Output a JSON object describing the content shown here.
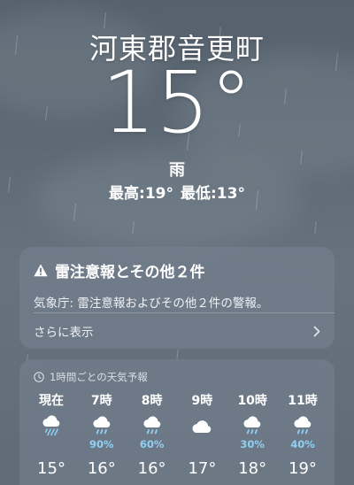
{
  "location": {
    "city": "河東郡音更町"
  },
  "current": {
    "temperature": "15°",
    "condition": "雨",
    "high": "最高:19°",
    "low": "最低:13°"
  },
  "alert": {
    "title": "雷注意報とその他２件",
    "body": "気象庁: 雷注意報およびその他２件の警報。",
    "more_label": "さらに表示",
    "icon": "warning-icon"
  },
  "hourly": {
    "header": "1時間ごとの天気予報",
    "header_icon": "clock-icon",
    "accent_color": "#8fd0f5",
    "items": [
      {
        "label": "現在",
        "icon": "heavy-rain-icon",
        "prob": "",
        "temp": "15°"
      },
      {
        "label": "7時",
        "icon": "rain-icon",
        "prob": "90%",
        "temp": "16°"
      },
      {
        "label": "8時",
        "icon": "rain-icon",
        "prob": "60%",
        "temp": "16°"
      },
      {
        "label": "9時",
        "icon": "cloud-icon",
        "prob": "",
        "temp": "17°"
      },
      {
        "label": "10時",
        "icon": "rain-icon",
        "prob": "30%",
        "temp": "18°"
      },
      {
        "label": "11時",
        "icon": "rain-icon",
        "prob": "40%",
        "temp": "19°"
      }
    ]
  }
}
